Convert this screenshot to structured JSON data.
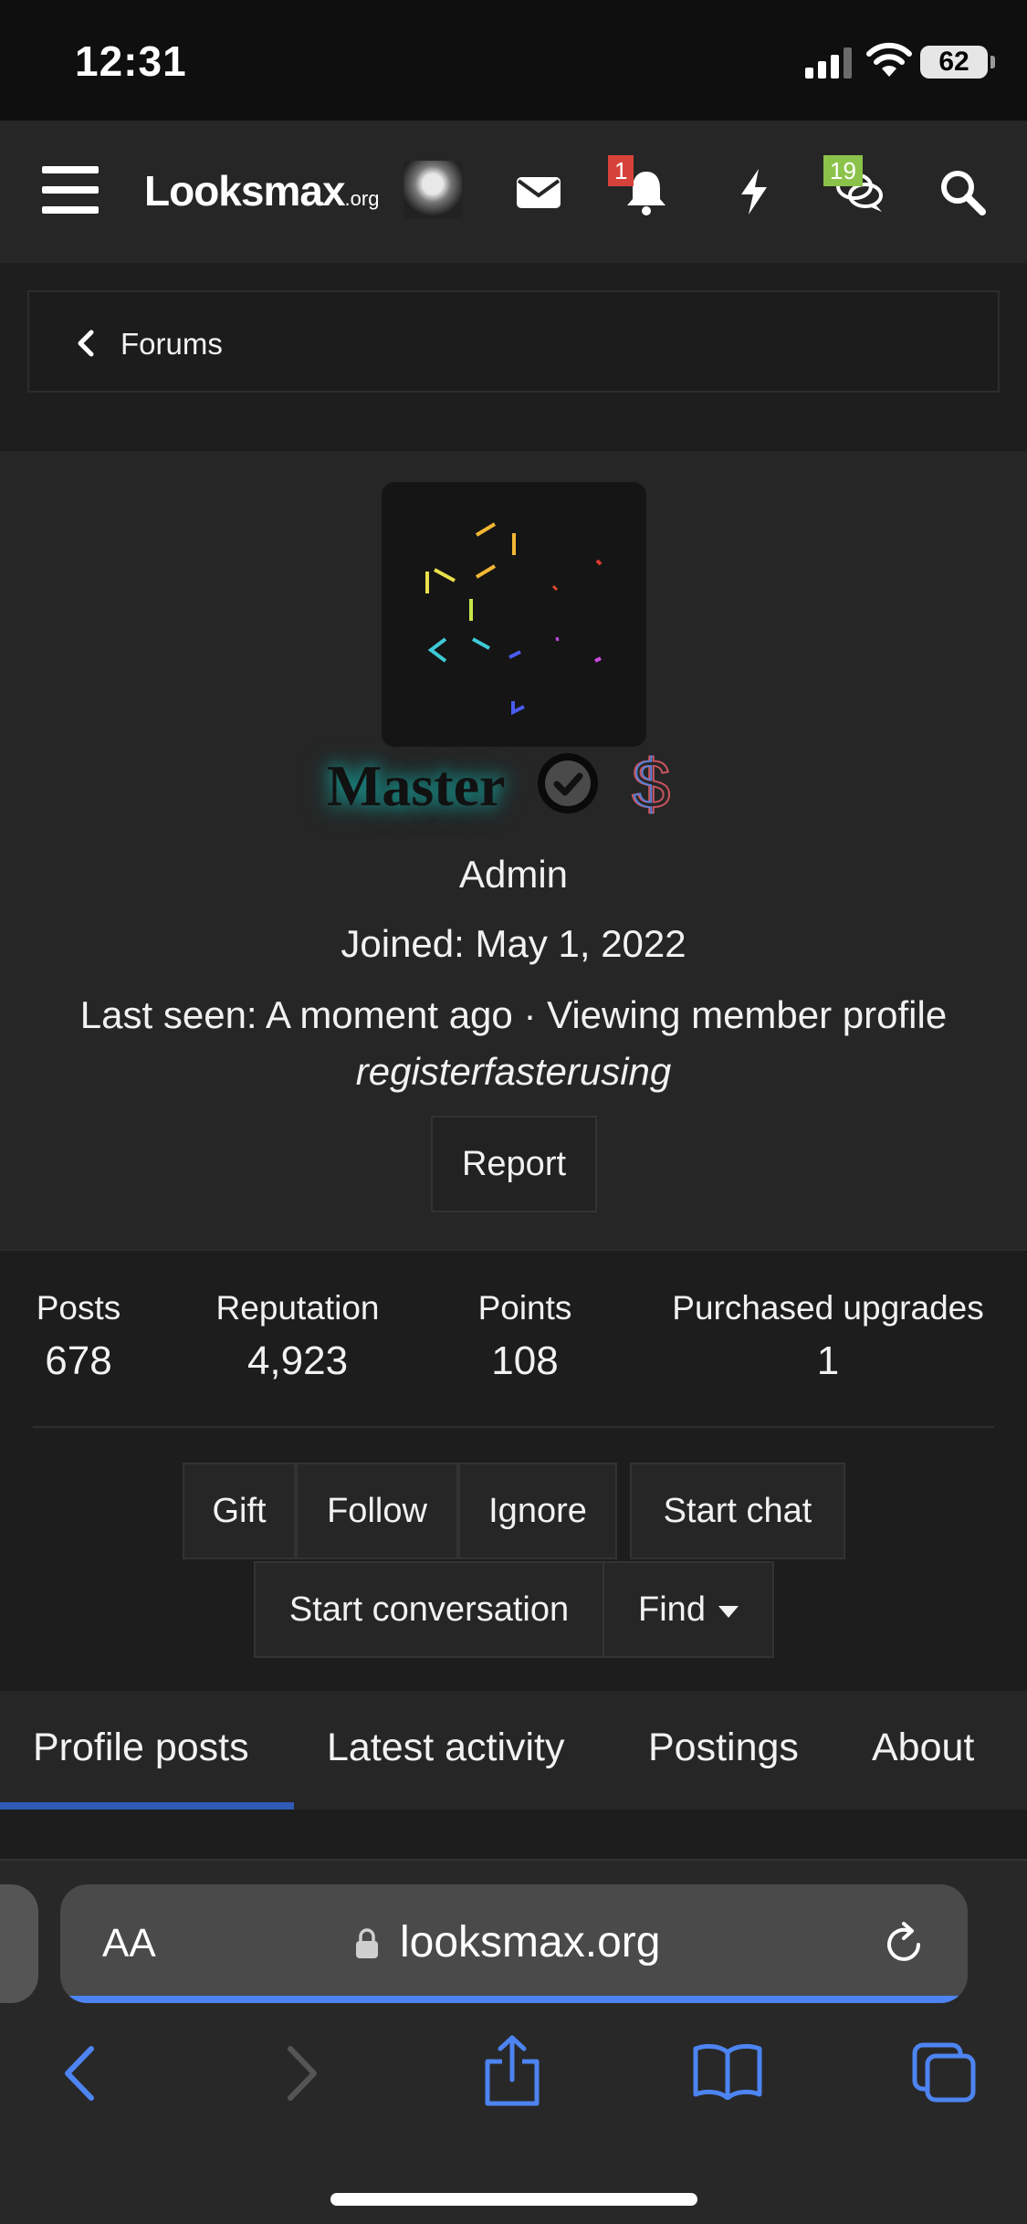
{
  "status_bar": {
    "time": "12:31",
    "battery": "62"
  },
  "header": {
    "logo_main": "Looksmax",
    "logo_suffix": ".org",
    "icons": [
      "menu-icon",
      "envelope-icon",
      "bell-icon",
      "bolt-icon",
      "chat-bubbles-icon",
      "search-icon"
    ],
    "notification_badge": "1",
    "chat_badge": "19",
    "badge_colors": {
      "notifications": "#d6423a",
      "chat": "#8bc34a"
    }
  },
  "breadcrumb": {
    "label": "Forums"
  },
  "profile": {
    "username": "Master",
    "role": "Admin",
    "joined": "Joined: May 1, 2022",
    "last_seen": "Last seen: A moment ago · Viewing member profile",
    "tagline": "registerfasterusing",
    "report_label": "Report",
    "dollar_glyph": "$"
  },
  "stats": [
    {
      "label": "Posts",
      "value": "678"
    },
    {
      "label": "Reputation",
      "value": "4,923"
    },
    {
      "label": "Points",
      "value": "108"
    },
    {
      "label": "Purchased upgrades",
      "value": "1"
    }
  ],
  "actions": {
    "gift": "Gift",
    "follow": "Follow",
    "ignore": "Ignore",
    "start_chat": "Start chat",
    "start_conversation": "Start conversation",
    "find": "Find"
  },
  "tabs": [
    "Profile posts",
    "Latest activity",
    "Postings",
    "About"
  ],
  "browser": {
    "text_size_label": "AA",
    "url": "looksmax.org",
    "accent_color": "#4d84f2"
  }
}
